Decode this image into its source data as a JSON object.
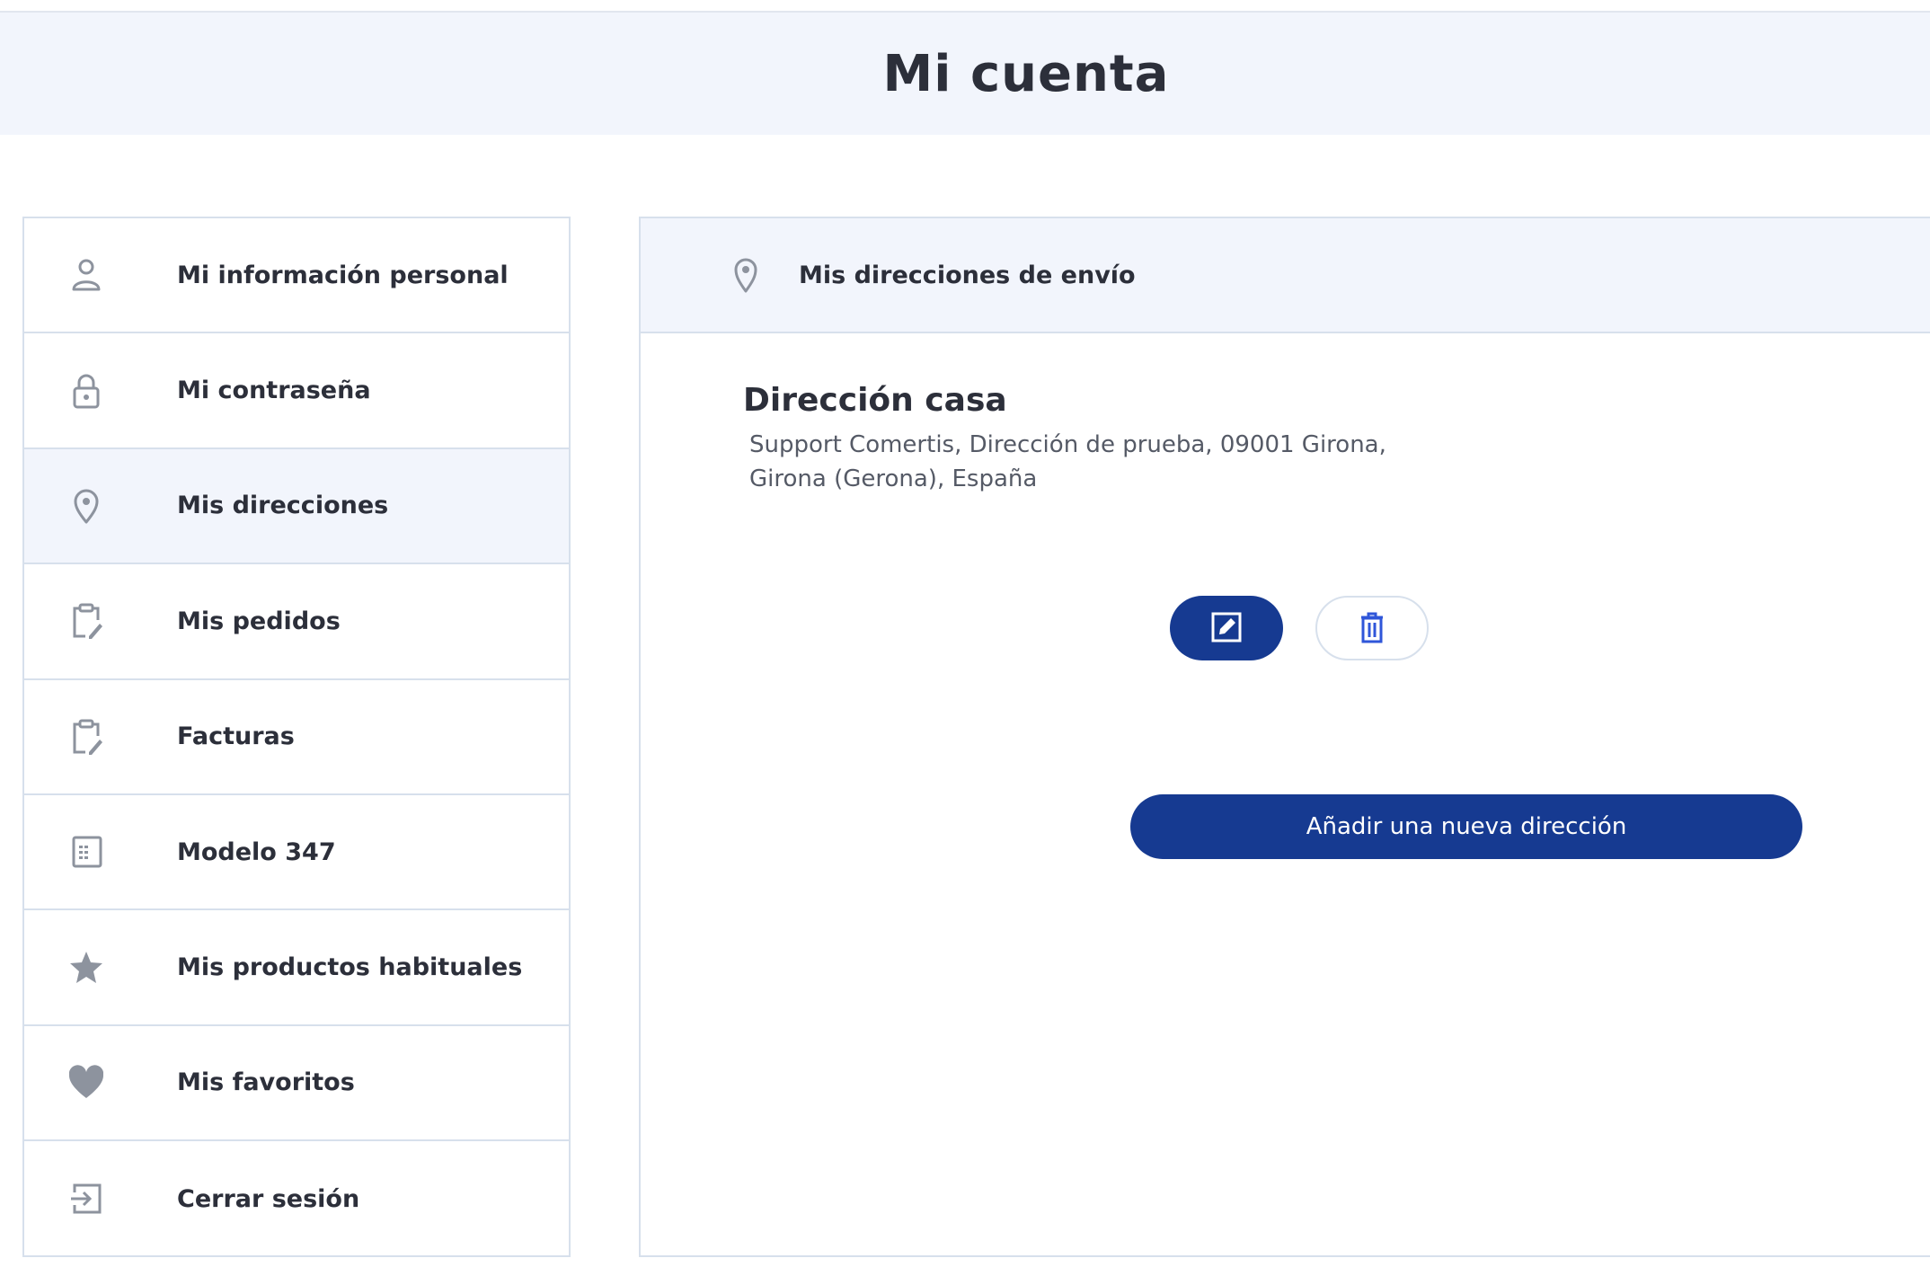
{
  "header": {
    "title": "Mi cuenta"
  },
  "sidebar": {
    "items": [
      {
        "label": "Mi información personal",
        "icon": "user-icon"
      },
      {
        "label": "Mi contraseña",
        "icon": "lock-icon"
      },
      {
        "label": "Mis direcciones",
        "icon": "map-pin-icon",
        "active": true
      },
      {
        "label": "Mis pedidos",
        "icon": "clipboard-edit-icon"
      },
      {
        "label": "Facturas",
        "icon": "clipboard-edit-icon"
      },
      {
        "label": "Modelo 347",
        "icon": "calculator-icon"
      },
      {
        "label": "Mis productos habituales",
        "icon": "star-icon"
      },
      {
        "label": "Mis favoritos",
        "icon": "heart-icon"
      },
      {
        "label": "Cerrar sesión",
        "icon": "logout-icon"
      }
    ]
  },
  "main": {
    "section_title": "Mis direcciones de envío",
    "address": {
      "name": "Dirección casa",
      "line1": "Support Comertis, Dirección de prueba, 09001 Girona,",
      "line2": "Girona (Gerona), España"
    },
    "add_button_label": "Añadir una nueva dirección"
  },
  "colors": {
    "primary": "#163a91",
    "header_bg": "#f2f5fc",
    "border": "#d7e0ec",
    "icon_gray": "#8d939e",
    "delete_icon": "#2f56d9"
  }
}
